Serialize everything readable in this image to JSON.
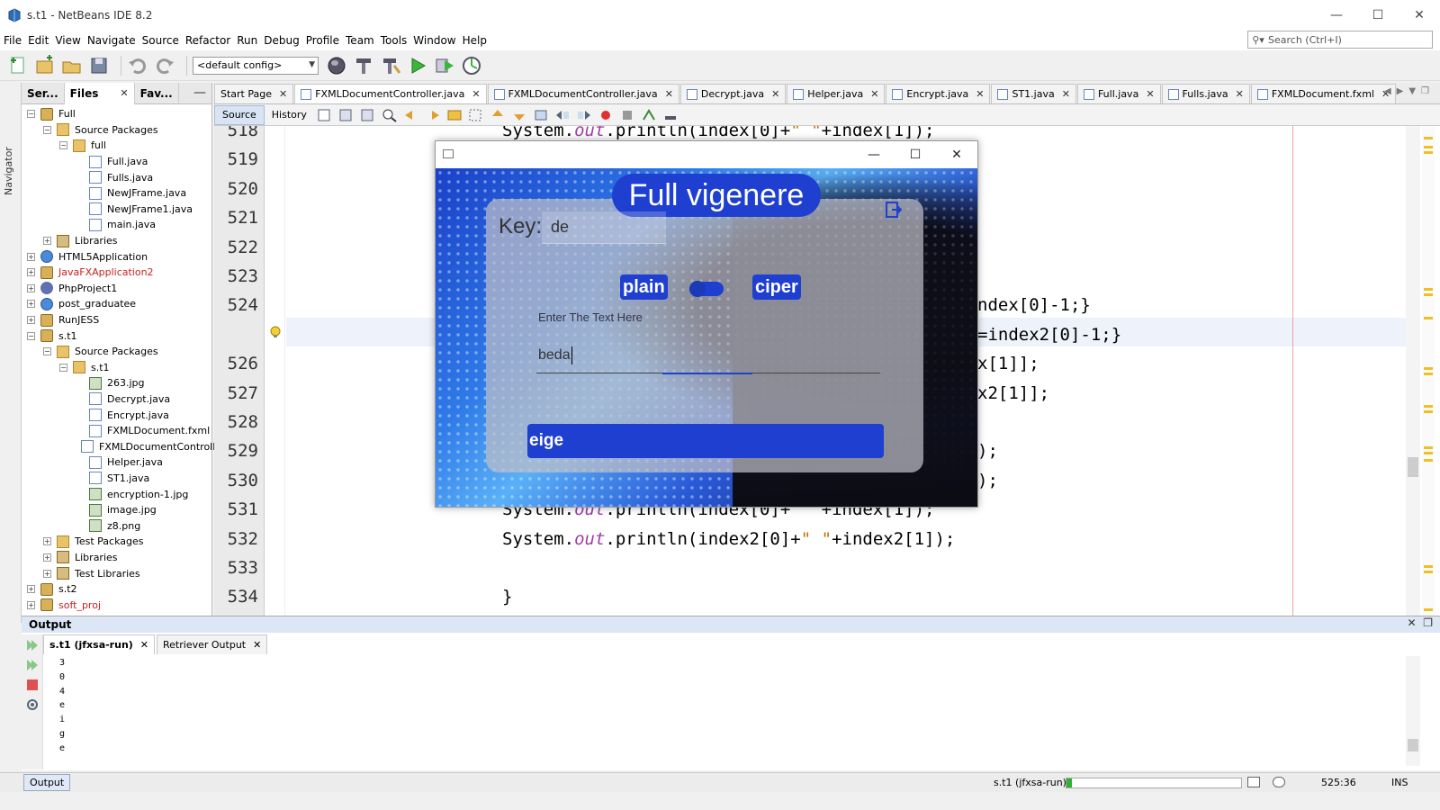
{
  "window": {
    "title": "s.t1 - NetBeans IDE 8.2",
    "controls": [
      "—",
      "☐",
      "✕"
    ]
  },
  "menu": [
    "File",
    "Edit",
    "View",
    "Navigate",
    "Source",
    "Refactor",
    "Run",
    "Debug",
    "Profile",
    "Team",
    "Tools",
    "Window",
    "Help"
  ],
  "search": {
    "placeholder": "Search (Ctrl+I)"
  },
  "toolbar": {
    "config": "<default config>"
  },
  "navigator": {
    "label": "Navigator"
  },
  "projects": {
    "tabs": [
      "Ser...",
      "Files",
      "Fav..."
    ],
    "tree": [
      {
        "label": "Full",
        "level": 0,
        "exp": "-",
        "icon": "proj"
      },
      {
        "label": "Source Packages",
        "level": 1,
        "exp": "-",
        "icon": "pkg"
      },
      {
        "label": "full",
        "level": 2,
        "exp": "-",
        "icon": "pkg"
      },
      {
        "label": "Full.java",
        "level": 3,
        "exp": "",
        "icon": "file"
      },
      {
        "label": "Fulls.java",
        "level": 3,
        "exp": "",
        "icon": "file"
      },
      {
        "label": "NewJFrame.java",
        "level": 3,
        "exp": "",
        "icon": "file"
      },
      {
        "label": "NewJFrame1.java",
        "level": 3,
        "exp": "",
        "icon": "file"
      },
      {
        "label": "main.java",
        "level": 3,
        "exp": "",
        "icon": "file"
      },
      {
        "label": "Libraries",
        "level": 1,
        "exp": "+",
        "icon": "lib"
      },
      {
        "label": "HTML5Application",
        "level": 0,
        "exp": "+",
        "icon": "globe"
      },
      {
        "label": "JavaFXApplication2",
        "level": 0,
        "exp": "+",
        "icon": "proj",
        "red": true
      },
      {
        "label": "PhpProject1",
        "level": 0,
        "exp": "+",
        "icon": "php"
      },
      {
        "label": "post_graduatee",
        "level": 0,
        "exp": "+",
        "icon": "globe"
      },
      {
        "label": "RunJESS",
        "level": 0,
        "exp": "+",
        "icon": "proj"
      },
      {
        "label": "s.t1",
        "level": 0,
        "exp": "-",
        "icon": "proj"
      },
      {
        "label": "Source Packages",
        "level": 1,
        "exp": "-",
        "icon": "pkg"
      },
      {
        "label": "s.t1",
        "level": 2,
        "exp": "-",
        "icon": "pkg"
      },
      {
        "label": "263.jpg",
        "level": 3,
        "exp": "",
        "icon": "img"
      },
      {
        "label": "Decrypt.java",
        "level": 3,
        "exp": "",
        "icon": "file"
      },
      {
        "label": "Encrypt.java",
        "level": 3,
        "exp": "",
        "icon": "file"
      },
      {
        "label": "FXMLDocument.fxml",
        "level": 3,
        "exp": "",
        "icon": "file"
      },
      {
        "label": "FXMLDocumentControll",
        "level": 3,
        "exp": "",
        "icon": "file"
      },
      {
        "label": "Helper.java",
        "level": 3,
        "exp": "",
        "icon": "file"
      },
      {
        "label": "ST1.java",
        "level": 3,
        "exp": "",
        "icon": "file"
      },
      {
        "label": "encryption-1.jpg",
        "level": 3,
        "exp": "",
        "icon": "img"
      },
      {
        "label": "image.jpg",
        "level": 3,
        "exp": "",
        "icon": "img"
      },
      {
        "label": "z8.png",
        "level": 3,
        "exp": "",
        "icon": "img"
      },
      {
        "label": "Test Packages",
        "level": 1,
        "exp": "+",
        "icon": "pkg"
      },
      {
        "label": "Libraries",
        "level": 1,
        "exp": "+",
        "icon": "lib"
      },
      {
        "label": "Test Libraries",
        "level": 1,
        "exp": "+",
        "icon": "lib"
      },
      {
        "label": "s.t2",
        "level": 0,
        "exp": "+",
        "icon": "proj"
      },
      {
        "label": "soft_proj",
        "level": 0,
        "exp": "+",
        "icon": "proj",
        "red": true
      }
    ]
  },
  "editor": {
    "tabs": [
      "Start Page",
      "FXMLDocumentController.java",
      "FXMLDocumentController.java",
      "Decrypt.java",
      "Helper.java",
      "Encrypt.java",
      "ST1.java",
      "Full.java",
      "Fulls.java",
      "FXMLDocument.fxml"
    ],
    "active_tab": 1,
    "source_label": "Source",
    "history_label": "History",
    "line_numbers": [
      "518",
      "519",
      "520",
      "521",
      "522",
      "523",
      "524",
      "",
      "526",
      "527",
      "528",
      "529",
      "530",
      "531",
      "532",
      "533",
      "534"
    ],
    "code_lines": [
      "System.out.println(index[0]+\" \"+index[1]);",
      "System.out.println(index2[0]+\" \"+index2[1]);",
      "",
      "",
      "",
      "",
      "ndex[0]-1;}",
      "=index2[0]-1;}",
      "x[1]];",
      "x2[1]];",
      "",
      ");",
      ");",
      "System.out.println(index[0]+\" \"+index[1]);",
      "System.out.println(index2[0]+\" \"+index2[1]);",
      "",
      "}"
    ]
  },
  "fxapp": {
    "heading": "Full vigenere",
    "key_label": "Key:",
    "key_value": "de",
    "plain_label": "plain",
    "ciper_label": "ciper",
    "text_label": "Enter The Text Here",
    "text_value": "beda",
    "result": "eige",
    "controls": [
      "—",
      "☐",
      "✕"
    ]
  },
  "output": {
    "title": "Output",
    "tabs": [
      "s.t1 (jfxsa-run)",
      "Retriever Output"
    ],
    "lines": [
      "3",
      "0",
      "4",
      "e",
      "i",
      "g",
      "e"
    ]
  },
  "status": {
    "output_button": "Output",
    "run_label": "s.t1 (jfxsa-run)",
    "position": "525:36",
    "mode": "INS"
  },
  "colors": {
    "accent": "#1e3fd0",
    "code_keyword": "#a03da8",
    "title_bg": "#ffffff"
  }
}
